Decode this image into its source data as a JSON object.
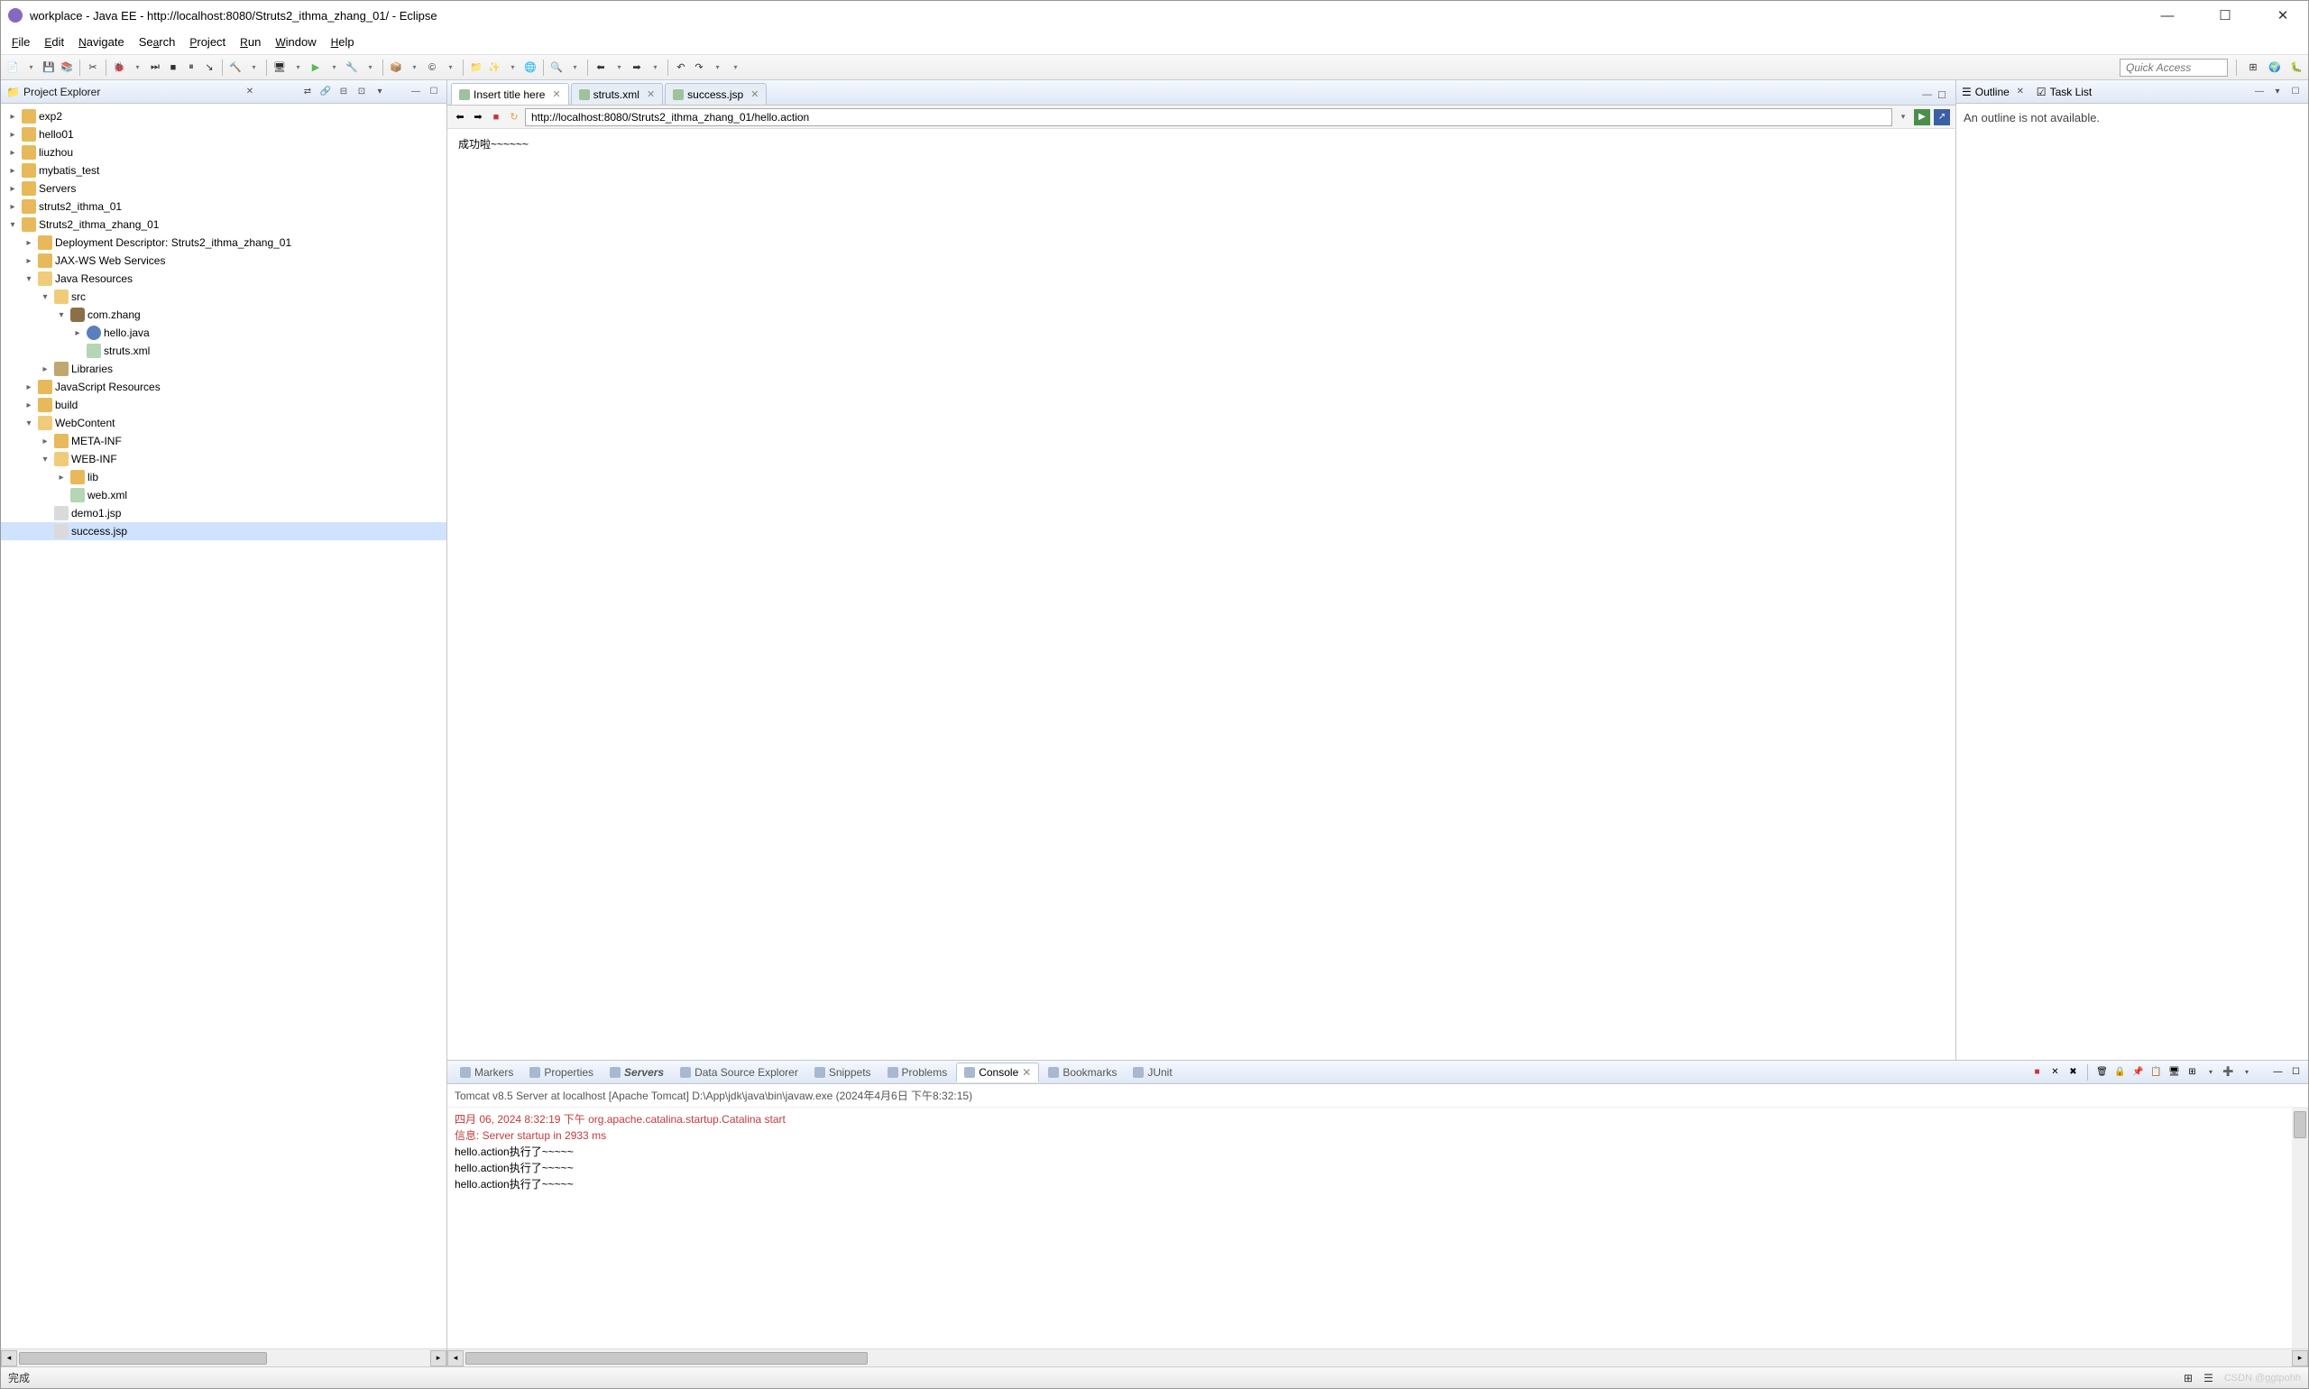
{
  "window": {
    "title": "workplace - Java EE - http://localhost:8080/Struts2_ithma_zhang_01/ - Eclipse"
  },
  "menubar": [
    {
      "l": "File",
      "u": "F"
    },
    {
      "l": "Edit",
      "u": "E"
    },
    {
      "l": "Navigate",
      "u": "N"
    },
    {
      "l": "Search",
      "u": "a"
    },
    {
      "l": "Project",
      "u": "P"
    },
    {
      "l": "Run",
      "u": "R"
    },
    {
      "l": "Window",
      "u": "W"
    },
    {
      "l": "Help",
      "u": "H"
    }
  ],
  "toolbar": {
    "quick_access_placeholder": "Quick Access"
  },
  "project_explorer": {
    "title": "Project Explorer",
    "tree": [
      {
        "d": 0,
        "tw": "▸",
        "ic": "ti-proj",
        "l": "exp2"
      },
      {
        "d": 0,
        "tw": "▸",
        "ic": "ti-proj",
        "l": "hello01"
      },
      {
        "d": 0,
        "tw": "▸",
        "ic": "ti-proj",
        "l": "liuzhou"
      },
      {
        "d": 0,
        "tw": "▸",
        "ic": "ti-proj",
        "l": "mybatis_test"
      },
      {
        "d": 0,
        "tw": "▸",
        "ic": "ti-folder",
        "l": "Servers"
      },
      {
        "d": 0,
        "tw": "▸",
        "ic": "ti-proj",
        "l": "struts2_ithma_01"
      },
      {
        "d": 0,
        "tw": "▾",
        "ic": "ti-proj",
        "l": "Struts2_ithma_zhang_01"
      },
      {
        "d": 1,
        "tw": "▸",
        "ic": "ti-folder",
        "l": "Deployment Descriptor: Struts2_ithma_zhang_01"
      },
      {
        "d": 1,
        "tw": "▸",
        "ic": "ti-folder",
        "l": "JAX-WS Web Services"
      },
      {
        "d": 1,
        "tw": "▾",
        "ic": "ti-folder-open",
        "l": "Java Resources"
      },
      {
        "d": 2,
        "tw": "▾",
        "ic": "ti-folder-open",
        "l": "src"
      },
      {
        "d": 3,
        "tw": "▾",
        "ic": "ti-pkg",
        "l": "com.zhang"
      },
      {
        "d": 4,
        "tw": "▸",
        "ic": "ti-java",
        "l": "hello.java"
      },
      {
        "d": 4,
        "tw": " ",
        "ic": "ti-xml",
        "l": "struts.xml"
      },
      {
        "d": 2,
        "tw": "▸",
        "ic": "ti-lib",
        "l": "Libraries"
      },
      {
        "d": 1,
        "tw": "▸",
        "ic": "ti-folder",
        "l": "JavaScript Resources"
      },
      {
        "d": 1,
        "tw": "▸",
        "ic": "ti-folder",
        "l": "build"
      },
      {
        "d": 1,
        "tw": "▾",
        "ic": "ti-folder-open",
        "l": "WebContent"
      },
      {
        "d": 2,
        "tw": "▸",
        "ic": "ti-folder",
        "l": "META-INF"
      },
      {
        "d": 2,
        "tw": "▾",
        "ic": "ti-folder-open",
        "l": "WEB-INF"
      },
      {
        "d": 3,
        "tw": "▸",
        "ic": "ti-folder",
        "l": "lib"
      },
      {
        "d": 3,
        "tw": " ",
        "ic": "ti-xml",
        "l": "web.xml"
      },
      {
        "d": 2,
        "tw": " ",
        "ic": "ti-jsp",
        "l": "demo1.jsp"
      },
      {
        "d": 2,
        "tw": " ",
        "ic": "ti-jsp",
        "l": "success.jsp",
        "sel": true
      }
    ]
  },
  "editor": {
    "tabs": [
      {
        "label": "Insert title here",
        "active": true
      },
      {
        "label": "struts.xml"
      },
      {
        "label": "success.jsp"
      }
    ],
    "url": "http://localhost:8080/Struts2_ithma_zhang_01/hello.action",
    "content": "成功啦~~~~~~"
  },
  "outline": {
    "title": "Outline",
    "tasklist": "Task List",
    "body": "An outline is not available."
  },
  "bottom": {
    "tabs": [
      {
        "l": "Markers"
      },
      {
        "l": "Properties"
      },
      {
        "l": "Servers",
        "bold": true
      },
      {
        "l": "Data Source Explorer"
      },
      {
        "l": "Snippets"
      },
      {
        "l": "Problems"
      },
      {
        "l": "Console",
        "active": true
      },
      {
        "l": "Bookmarks"
      },
      {
        "l": "JUnit"
      }
    ],
    "header": "Tomcat v8.5 Server at localhost [Apache Tomcat] D:\\App\\jdk\\java\\bin\\javaw.exe (2024年4月6日 下午8:32:15)",
    "lines": [
      {
        "t": "四月 06, 2024 8:32:19 下午 org.apache.catalina.startup.Catalina start",
        "red": true
      },
      {
        "t": "信息: Server startup in 2933 ms",
        "red": true
      },
      {
        "t": "hello.action执行了~~~~~"
      },
      {
        "t": "hello.action执行了~~~~~"
      },
      {
        "t": "hello.action执行了~~~~~"
      }
    ]
  },
  "statusbar": {
    "left": "完成",
    "watermark": "CSDN @ggtpohh"
  }
}
